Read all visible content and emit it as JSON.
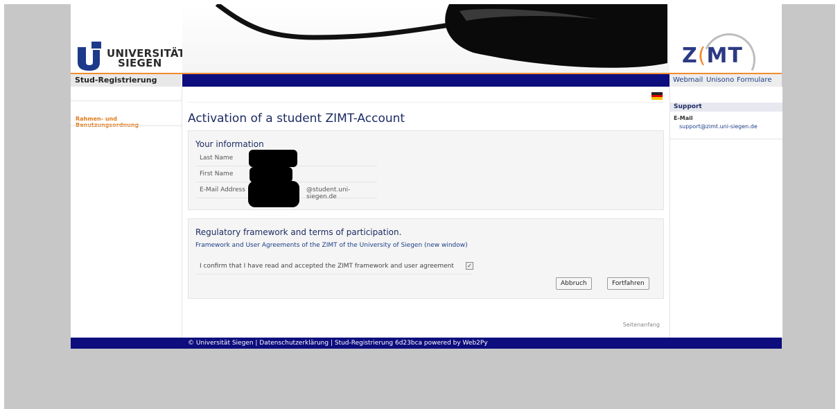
{
  "logo": {
    "line1": "UNIVERSITÄT",
    "line2": "SIEGEN"
  },
  "zimt_logo": {
    "left": "Z",
    "paren": "(",
    "right": "MT"
  },
  "nav": {
    "section_title": "Stud-Registrierung",
    "links": [
      "Webmail",
      "Unisono",
      "Formulare"
    ]
  },
  "sidebar": {
    "link": "Rahmen- und Benutzungsordnung"
  },
  "main": {
    "title": "Activation of a student ZIMT-Account",
    "info_panel": {
      "heading": "Your information",
      "fields": [
        {
          "label": "Last Name",
          "value": ""
        },
        {
          "label": "First Name",
          "value": ""
        },
        {
          "label": "E-Mail Address",
          "value": "@student.uni-siegen.de"
        }
      ]
    },
    "terms_panel": {
      "heading": "Regulatory framework and terms of participation.",
      "link": "Framework and User Agreements of the ZIMT of the University of Siegen (new window)",
      "confirm_text": "I confirm that I have read and accepted the ZIMT framework and user agreement",
      "confirm_checked": true,
      "checkmark": "✓"
    },
    "buttons": {
      "cancel": "Abbruch",
      "continue": "Fortfahren"
    },
    "top_link": "Seitenanfang"
  },
  "support": {
    "heading": "Support",
    "email_label": "E-Mail",
    "email": "support@zimt.uni-siegen.de"
  },
  "footer": {
    "text": "© Universität Siegen | Datenschutzerklärung | Stud-Registrierung 6d23bca powered by Web2Py"
  },
  "colors": {
    "navy": "#0d0d7e",
    "orange": "#f08c2e",
    "title": "#1d2b62"
  }
}
